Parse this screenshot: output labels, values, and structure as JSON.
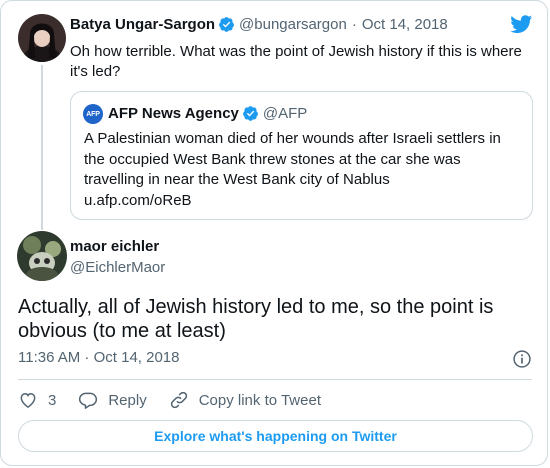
{
  "colors": {
    "accent": "#1d9bf0",
    "text": "#0f1419",
    "secondary": "#536471",
    "border": "#cfd9de",
    "afp_blue": "#1f64c8"
  },
  "icons": {
    "logo": "twitter-bird-icon",
    "verified": "verified-badge-icon",
    "like": "heart-icon",
    "reply": "reply-bubble-icon",
    "copy": "link-icon",
    "info": "info-icon"
  },
  "parent_tweet": {
    "name": "Batya Ungar-Sargon",
    "handle": "@bungarsargon",
    "separator": "·",
    "date": "Oct 14, 2018",
    "text": "Oh how terrible. What was the point of Jewish history if this is where it's led?",
    "quoted": {
      "avatar_text": "AFP",
      "name": "AFP News Agency",
      "handle": "@AFP",
      "text": "A Palestinian woman died of her wounds after Israeli settlers in the occupied West Bank threw stones at the car she was travelling in near the West Bank city of Nablus",
      "link": "u.afp.com/oReB"
    }
  },
  "reply_tweet": {
    "name": "maor eichler",
    "handle": "@EichlerMaor",
    "text": "Actually, all of Jewish history led to me, so the point is obvious (to me at least)",
    "timestamp": "11:36 AM · Oct 14, 2018"
  },
  "actions": {
    "like_count": "3",
    "reply_label": "Reply",
    "copy_label": "Copy link to Tweet"
  },
  "explore_label": "Explore what's happening on Twitter"
}
